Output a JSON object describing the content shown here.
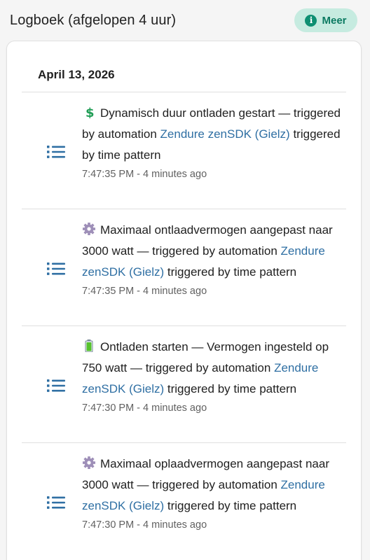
{
  "header": {
    "title": "Logboek (afgelopen 4 uur)",
    "more_button_label": "Meer",
    "more_button_icon": "info-icon"
  },
  "logbook": {
    "date": "April 13, 2026",
    "entries": [
      {
        "emoji": "dollar-sign-icon",
        "message": "Dynamisch duur ontladen gestart — triggered by automation",
        "entity": "Zendure zenSDK (Gielz)",
        "suffix": "triggered by time pattern",
        "time": "7:47:35 PM - 4 minutes ago"
      },
      {
        "emoji": "gear-icon",
        "message": "Maximaal ontlaadvermogen aangepast naar 3000 watt — triggered by automation",
        "entity": "Zendure zenSDK (Gielz)",
        "suffix": "triggered by time pattern",
        "time": "7:47:35 PM - 4 minutes ago"
      },
      {
        "emoji": "battery-icon",
        "message": "Ontladen starten — Vermogen ingesteld op 750 watt — triggered by automation",
        "entity": "Zendure zenSDK (Gielz)",
        "suffix": "triggered by time pattern",
        "time": "7:47:30 PM - 4 minutes ago"
      },
      {
        "emoji": "gear-icon",
        "message": "Maximaal oplaadvermogen aangepast naar 3000 watt — triggered by automation",
        "entity": "Zendure zenSDK (Gielz)",
        "suffix": "triggered by time pattern",
        "time": "7:47:30 PM - 4 minutes ago"
      }
    ]
  },
  "colors": {
    "accent": "#0e8f72",
    "accent_bg": "#c6ebe0",
    "link": "#2f6fa3",
    "list_icon": "#2f6fa3"
  }
}
